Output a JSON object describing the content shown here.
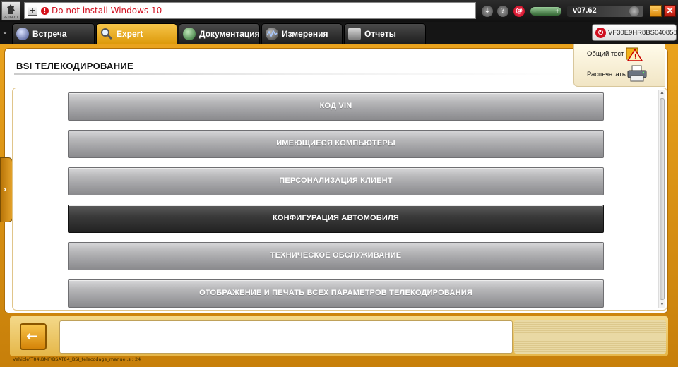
{
  "logo": {
    "text": "PEUGEOT"
  },
  "message_bar": {
    "text": "Do not install Windows 10"
  },
  "toolbar": {
    "version": "v07.62",
    "minimize_label": "–",
    "close_label": "✕",
    "email_glyph": "@",
    "battery_minus": "−",
    "battery_plus": "+"
  },
  "tabs": [
    {
      "label": "Встреча",
      "icon": "meeting-icon"
    },
    {
      "label": "Expert",
      "icon": "magnifier-icon",
      "active": true
    },
    {
      "label": "Документация",
      "icon": "documentation-icon"
    },
    {
      "label": "Измерения",
      "icon": "oscilloscope-icon"
    },
    {
      "label": "Отчеты",
      "icon": "reports-icon"
    }
  ],
  "vin": {
    "text": "VF30E9HR8BS040858"
  },
  "page": {
    "title": "BSI  ТЕЛЕКОДИРОВАНИЕ"
  },
  "right_panel": {
    "test_label": "Общий тест",
    "print_label": "Распечатать"
  },
  "menu": {
    "items": [
      {
        "label": "КОД VIN",
        "selected": false
      },
      {
        "label": "ИМЕЮЩИЕСЯ КОМПЬЮТЕРЫ",
        "selected": false
      },
      {
        "label": "ПЕРСОНАЛИЗАЦИЯ КЛИЕНТ",
        "selected": false
      },
      {
        "label": "КОНФИГУРАЦИЯ АВТОМОБИЛЯ",
        "selected": true
      },
      {
        "label": "ТЕХНИЧЕСКОЕ ОБСЛУЖИВАНИЕ",
        "selected": false
      },
      {
        "label": "ОТОБРАЖЕНИЕ И ПЕЧАТЬ ВСЕХ ПАРАМЕТРОВ ТЕЛЕКОДИРОВАНИЯ",
        "selected": false
      }
    ]
  },
  "status": {
    "path": "Vehicle\\T84\\BMF\\BSAT84_BSI_telecodage_manuel.s : 24"
  },
  "colors": {
    "accent": "#e9a21d",
    "alert": "#d01020",
    "selected_button": "#333333"
  }
}
